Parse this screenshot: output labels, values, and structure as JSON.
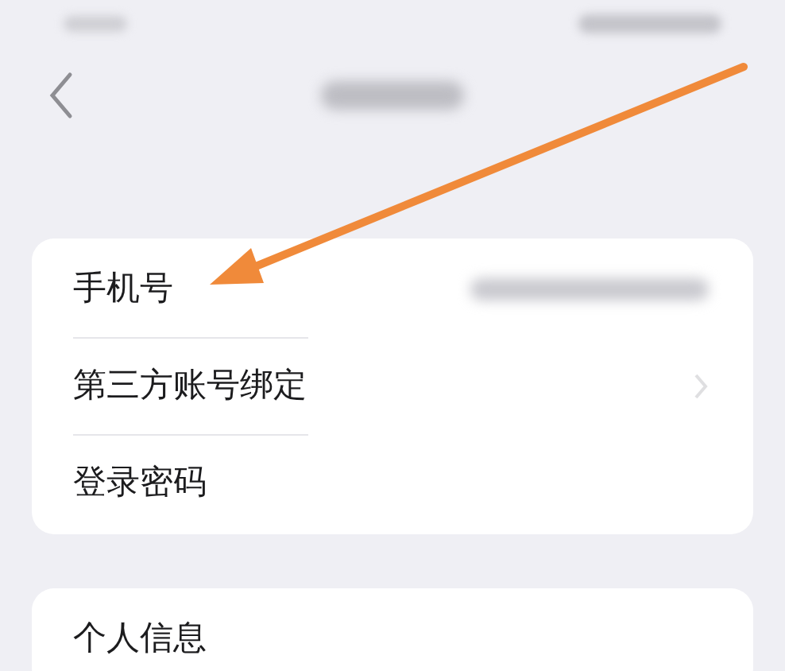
{
  "sections": [
    {
      "rows": [
        {
          "label": "手机号",
          "kind": "value"
        },
        {
          "label": "第三方账号绑定",
          "kind": "link"
        },
        {
          "label": "登录密码",
          "kind": "plain"
        }
      ]
    },
    {
      "rows": [
        {
          "label": "个人信息",
          "kind": "plain"
        }
      ]
    }
  ]
}
